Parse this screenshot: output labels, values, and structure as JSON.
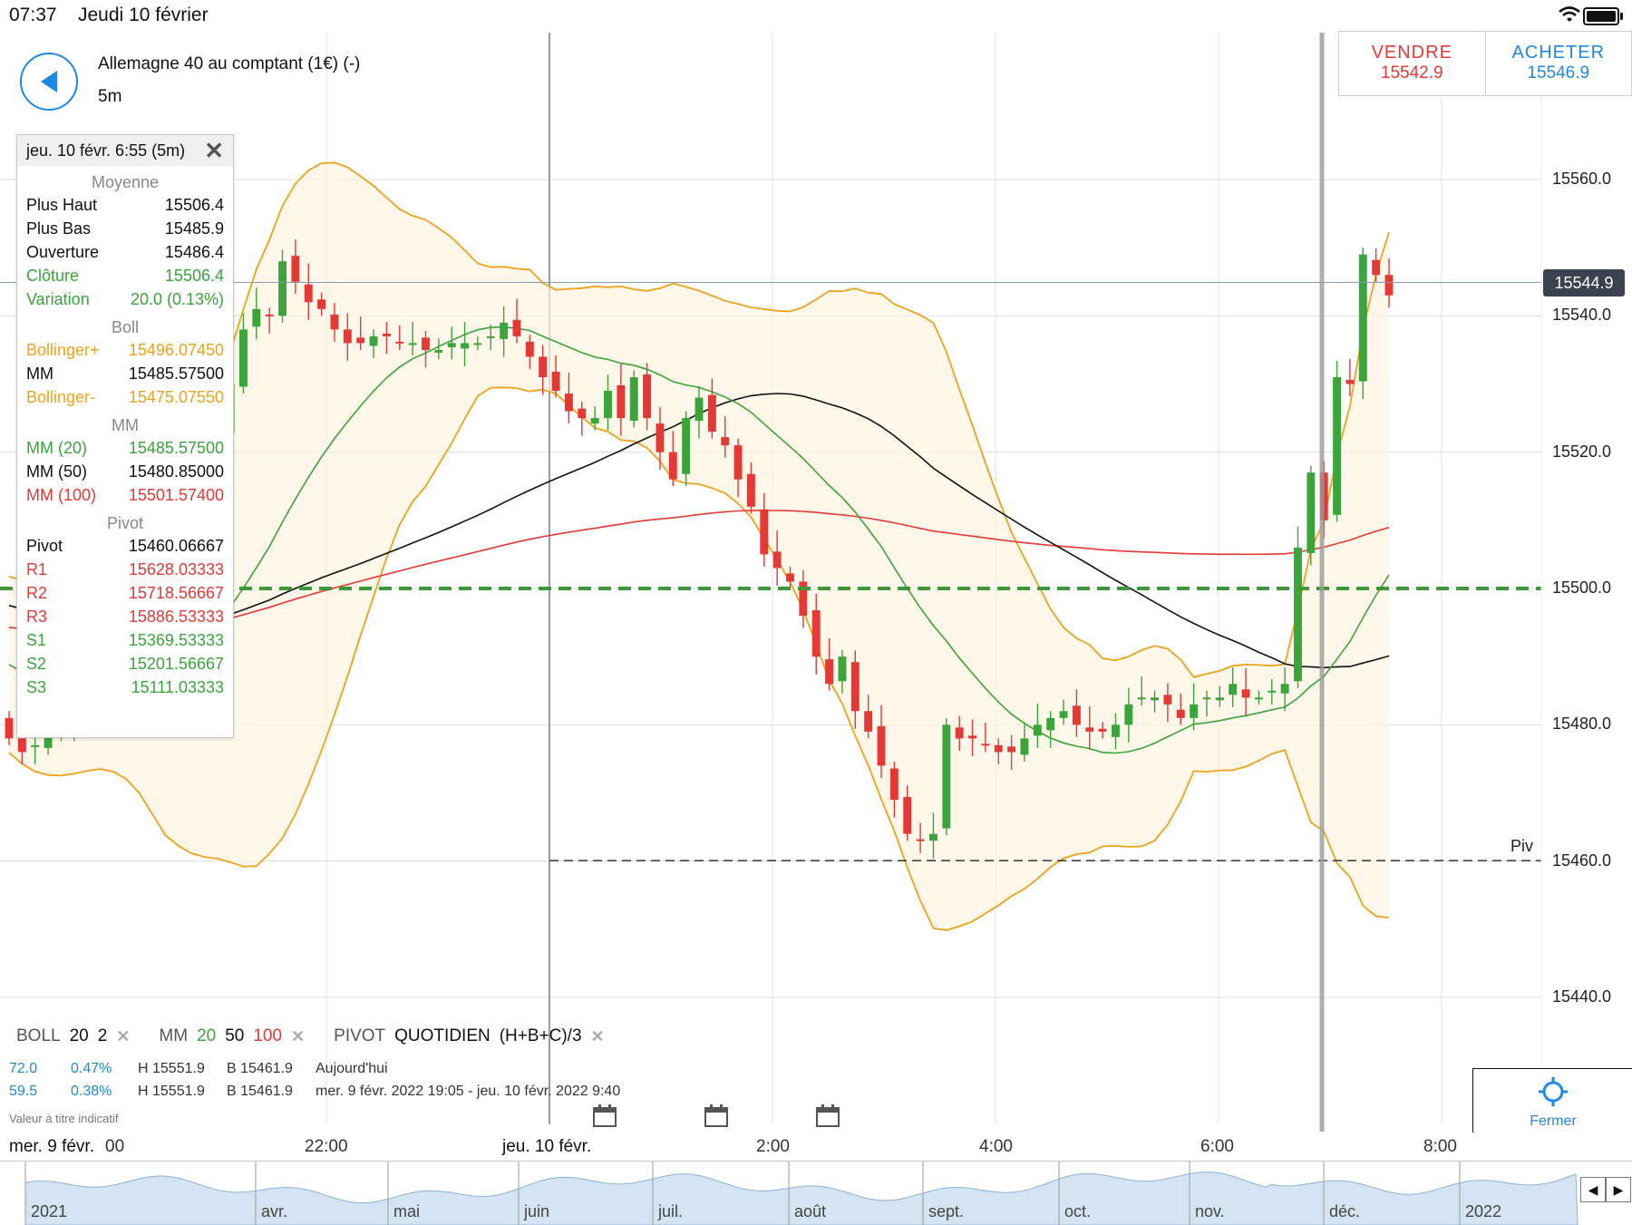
{
  "status_bar": {
    "time": "07:37",
    "date": "Jeudi 10 février"
  },
  "header": {
    "instrument": "Allemagne 40 au comptant (1€) (-)",
    "timeframe": "5m"
  },
  "trade": {
    "sell_label": "VENDRE",
    "sell_price": "15542.9",
    "buy_label": "ACHETER",
    "buy_price": "15546.9"
  },
  "tooltip": {
    "header": "jeu. 10 févr. 6:55 (5m)",
    "sections": {
      "moyenne": "Moyenne",
      "boll": "Boll",
      "mm": "MM",
      "pivot": "Pivot"
    },
    "moyenne_rows": [
      {
        "label": "Plus Haut",
        "value": "15506.4"
      },
      {
        "label": "Plus Bas",
        "value": "15485.9"
      },
      {
        "label": "Ouverture",
        "value": "15486.4"
      },
      {
        "label": "Clôture",
        "value": "15506.4"
      },
      {
        "label": "Variation",
        "value": "20.0 (0.13%)"
      }
    ],
    "boll_rows": [
      {
        "label": "Bollinger+",
        "value": "15496.07450"
      },
      {
        "label": "MM",
        "value": "15485.57500"
      },
      {
        "label": "Bollinger-",
        "value": "15475.07550"
      }
    ],
    "mm_rows": [
      {
        "label": "MM (20)",
        "value": "15485.57500"
      },
      {
        "label": "MM (50)",
        "value": "15480.85000"
      },
      {
        "label": "MM (100)",
        "value": "15501.57400"
      }
    ],
    "pivot_rows": [
      {
        "label": "Pivot",
        "value": "15460.06667"
      },
      {
        "label": "R1",
        "value": "15628.03333"
      },
      {
        "label": "R2",
        "value": "15718.56667"
      },
      {
        "label": "R3",
        "value": "15886.53333"
      },
      {
        "label": "S1",
        "value": "15369.53333"
      },
      {
        "label": "S2",
        "value": "15201.56667"
      },
      {
        "label": "S3",
        "value": "15111.03333"
      }
    ]
  },
  "price_axis": [
    "15560.0",
    "15540.0",
    "15520.0",
    "15500.0",
    "15480.0",
    "15460.0",
    "15440.0"
  ],
  "current_price_tag": "15544.9",
  "pivot_line_label": "Piv",
  "indicators": {
    "boll_name": "BOLL",
    "boll_p1": "20",
    "boll_p2": "2",
    "mm_name": "MM",
    "mm_p1": "20",
    "mm_p2": "50",
    "mm_p3": "100",
    "pivot_name": "PIVOT",
    "pivot_type": "QUOTIDIEN",
    "pivot_formula": "(H+B+C)/3"
  },
  "stats": [
    {
      "pts": "72.0",
      "pct": "0.47%",
      "high": "H 15551.9",
      "low": "B 15461.9",
      "period": "Aujourd'hui"
    },
    {
      "pts": "59.5",
      "pct": "0.38%",
      "high": "H 15551.9",
      "low": "B 15461.9",
      "period": "mer. 9 févr. 2022 19:05 - jeu. 10 févr. 2022 9:40"
    }
  ],
  "disclaimer": "Valeur à titre indicatif",
  "close_label": "Fermer",
  "time_axis": {
    "date_left": "mer. 9 févr.",
    "date_left_tail": "00",
    "date_mid": "jeu. 10 févr.",
    "labels": [
      "22:00",
      "2:00",
      "4:00",
      "6:00",
      "8:00"
    ]
  },
  "navigator_months": [
    "2021",
    "avr.",
    "mai",
    "juin",
    "juil.",
    "août",
    "sept.",
    "oct.",
    "nov.",
    "déc.",
    "2022"
  ],
  "colors": {
    "up": "#3aa53a",
    "down": "#e53935",
    "bollinger": "#f0a21c",
    "mm20": "#3aa53a",
    "mm50": "#111111",
    "mm100": "#e53935",
    "accent": "#1e88e5"
  },
  "chart_data": {
    "type": "candlestick",
    "y_range": [
      15430,
      15570
    ],
    "pivot_level": 15460.06667,
    "green_level": 15500,
    "current_price": 15544.9,
    "candles_close_series": [
      15478,
      15476,
      15477,
      15479,
      15481,
      15484,
      15487,
      15489,
      15494,
      15498,
      15504,
      15512,
      15518,
      15516,
      15518,
      15519,
      15522,
      15530,
      15538,
      15541,
      15540,
      15548,
      15545,
      15542,
      15541,
      15538,
      15536,
      15536,
      15537,
      15537,
      15536,
      15536,
      15535,
      15535,
      15536,
      15536,
      15536,
      15537,
      15539,
      15537,
      15534,
      15531,
      15529,
      15526,
      15525,
      15525,
      15529,
      15525,
      15531,
      15525,
      15520,
      15516,
      15525,
      15528,
      15523,
      15521,
      15516,
      15512,
      15505,
      15503,
      15501,
      15496,
      15490,
      15486,
      15490,
      15482,
      15479,
      15474,
      15469,
      15464,
      15463,
      15464,
      15480,
      15478,
      15478,
      15477,
      15476,
      15476,
      15478,
      15480,
      15481,
      15482,
      15480,
      15479,
      15479,
      15480,
      15483,
      15484,
      15484,
      15483,
      15481,
      15483,
      15484,
      15484,
      15486,
      15484,
      15484,
      15485,
      15486,
      15506,
      15517,
      15510,
      15531,
      15530,
      15549,
      15546,
      15543
    ]
  }
}
